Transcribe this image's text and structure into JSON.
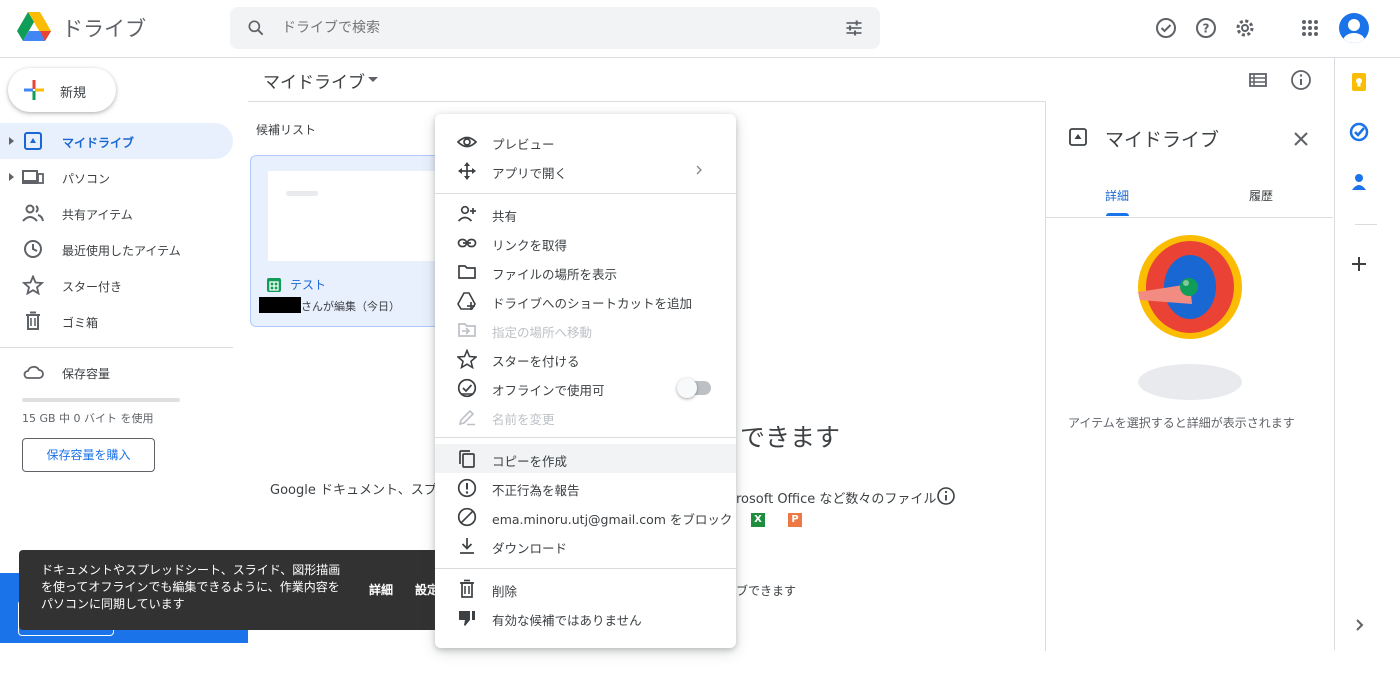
{
  "header": {
    "app_title": "ドライブ",
    "search_placeholder": "ドライブで検索",
    "brand_colors": {
      "blue": "#1a73e8",
      "green": "#0f9d58",
      "yellow": "#fbbc04",
      "red": "#ea4335"
    }
  },
  "sidebar": {
    "new_label": "新規",
    "items": [
      {
        "label": "マイドライブ",
        "icon": "my-drive-icon",
        "active": true
      },
      {
        "label": "パソコン",
        "icon": "computer-icon",
        "active": false
      },
      {
        "label": "共有アイテム",
        "icon": "shared-people-icon",
        "active": false
      },
      {
        "label": "最近使用したアイテム",
        "icon": "clock-icon",
        "active": false
      },
      {
        "label": "スター付き",
        "icon": "star-icon",
        "active": false
      },
      {
        "label": "ゴミ箱",
        "icon": "trash-icon",
        "active": false
      }
    ],
    "storage_label": "保存容量",
    "storage_text": "15 GB 中 0 バイト を使用",
    "storage_used_fraction": 0,
    "buy_storage_label": "保存容量を購入"
  },
  "main": {
    "title": "マイドライブ",
    "suggested_label": "候補リスト",
    "file_card": {
      "name": "テスト",
      "meta": "さんが編集（今日）"
    },
    "empty_heading": "できます",
    "empty_desc_a": "Google ドキュメント、スプレ",
    "empty_desc_b": "rosoft Office など数々のファイル",
    "x_icon_letter": "X",
    "p_icon_letter": "P",
    "empty_sub": "ブできます"
  },
  "details_panel": {
    "title": "マイドライブ",
    "tab_details": "詳細",
    "tab_history": "履歴",
    "hint": "アイテムを選択すると詳細が表示されます"
  },
  "snackbar": {
    "text": "ドキュメントやスプレッドシート、スライド、図形描画を使ってオフラインでも編集できるように、作業内容をパソコンに同期しています",
    "details_label": "詳細",
    "settings_label": "設定"
  },
  "context_menu": {
    "items": [
      {
        "label": "プレビュー",
        "icon": "eye-icon",
        "disabled": false
      },
      {
        "label": "アプリで開く",
        "icon": "move-arrows-icon",
        "disabled": false,
        "submenu": true
      },
      {
        "label": "共有",
        "icon": "add-person-icon",
        "disabled": false
      },
      {
        "label": "リンクを取得",
        "icon": "link-icon",
        "disabled": false
      },
      {
        "label": "ファイルの場所を表示",
        "icon": "folder-icon",
        "disabled": false
      },
      {
        "label": "ドライブへのショートカットを追加",
        "icon": "drive-shortcut-icon",
        "disabled": false
      },
      {
        "label": "指定の場所へ移動",
        "icon": "move-to-icon",
        "disabled": true
      },
      {
        "label": "スターを付ける",
        "icon": "star-icon",
        "disabled": false
      },
      {
        "label": "オフラインで使用可",
        "icon": "offline-check-icon",
        "disabled": false,
        "toggle": false
      },
      {
        "label": "名前を変更",
        "icon": "pencil-icon",
        "disabled": true
      },
      {
        "label": "コピーを作成",
        "icon": "copy-icon",
        "disabled": false,
        "highlighted": true
      },
      {
        "label": "不正行為を報告",
        "icon": "alert-icon",
        "disabled": false
      },
      {
        "label": "ema.minoru.utj@gmail.com をブロック",
        "icon": "block-icon",
        "disabled": false
      },
      {
        "label": "ダウンロード",
        "icon": "download-icon",
        "disabled": false
      },
      {
        "label": "削除",
        "icon": "trash-icon",
        "disabled": false
      },
      {
        "label": "有効な候補ではありません",
        "icon": "thumbs-down-icon",
        "disabled": false
      }
    ]
  }
}
